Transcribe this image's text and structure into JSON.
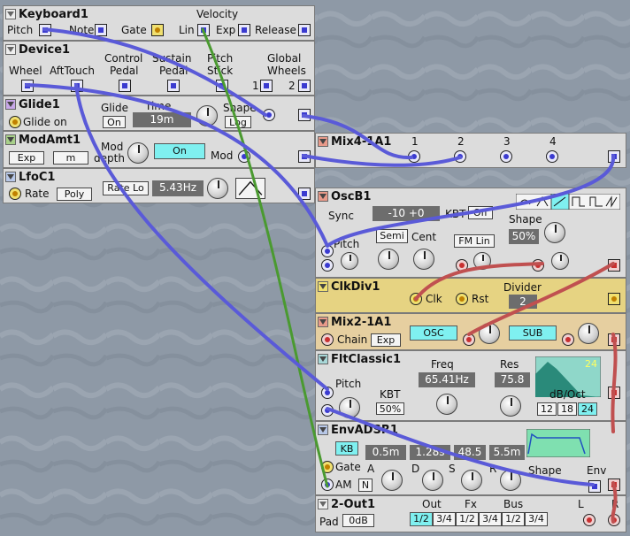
{
  "keyboard": {
    "title": "Keyboard1",
    "velocity": "Velocity",
    "pitch": "Pitch",
    "note": "Note",
    "gate": "Gate",
    "lin": "Lin",
    "exp": "Exp",
    "release": "Release"
  },
  "device": {
    "title": "Device1",
    "wheel": "Wheel",
    "aftertouch": "AftTouch",
    "control": "Control",
    "control2": "Pedal",
    "sustain": "Sustain",
    "sustain2": "Pedal",
    "pitch": "Pitch",
    "pitch2": "Stick",
    "global": "Global",
    "global2": "Wheels",
    "g1": "1",
    "g2": "2"
  },
  "glide": {
    "title": "Glide1",
    "glide_on": "Glide on",
    "glide": "Glide",
    "on_btn": "On",
    "time": "Time",
    "time_val": "19m",
    "shape": "Shape",
    "log_btn": "Log"
  },
  "modamt": {
    "title": "ModAmt1",
    "exp_btn": "Exp",
    "m_btn": "m",
    "mod": "Mod",
    "depth": "depth",
    "on_btn": "On",
    "mod_out": "Mod"
  },
  "lfo": {
    "title": "LfoC1",
    "rate": "Rate",
    "poly_btn": "Poly",
    "rate_btn": "Rate Lo",
    "freq": "5.43Hz"
  },
  "mix4": {
    "title": "Mix4-1A1",
    "c1": "1",
    "c2": "2",
    "c3": "3",
    "c4": "4"
  },
  "osc": {
    "title": "OscB1",
    "sync": "Sync",
    "detune": "-10 +0",
    "kbt": "KBT",
    "kbt_btn": "Off",
    "shape": "Shape",
    "shape_val": "50%",
    "pitch": "Pitch",
    "semi": "Semi",
    "cent": "Cent",
    "fm_btn": "FM Lin"
  },
  "clkdiv": {
    "title": "ClkDiv1",
    "clk": "Clk",
    "rst": "Rst",
    "divider": "Divider",
    "div_val": "2"
  },
  "mix2": {
    "title": "Mix2-1A1",
    "chain": "Chain",
    "exp_btn": "Exp",
    "osc": "OSC",
    "sub": "SUB"
  },
  "filter": {
    "title": "FltClassic1",
    "pitch": "Pitch",
    "kbt": "KBT",
    "kbt_val": "50%",
    "freq": "Freq",
    "freq_val": "65.41Hz",
    "res": "Res",
    "res_val": "75.8",
    "gain": "24",
    "slope": "dB/Oct",
    "s12": "12",
    "s18": "18",
    "s24": "24"
  },
  "env": {
    "title": "EnvADSR1",
    "kb_btn": "KB",
    "gate": "Gate",
    "am": "AM",
    "n_btn": "N",
    "a": "A",
    "d": "D",
    "s": "S",
    "r": "R",
    "a_val": "0.5m",
    "d_val": "1.28s",
    "s_val": "48.5",
    "r_val": "5.5m",
    "shape": "Shape",
    "env": "Env"
  },
  "out": {
    "title": "2-Out1",
    "pad": "Pad",
    "pad_btn": "0dB",
    "out": "Out",
    "fx": "Fx",
    "bus": "Bus",
    "o1": "1/2",
    "o2": "3/4",
    "f1": "1/2",
    "f2": "3/4",
    "b1": "1/2",
    "b2": "3/4",
    "l": "L",
    "r": "R"
  }
}
